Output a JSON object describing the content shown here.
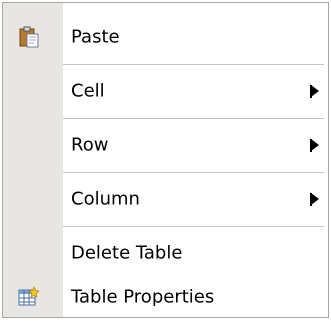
{
  "menu": {
    "items": [
      {
        "label": "Paste",
        "icon": "clipboard-paste-icon",
        "submenu": false
      },
      {
        "label": "Cell",
        "icon": null,
        "submenu": true
      },
      {
        "label": "Row",
        "icon": null,
        "submenu": true
      },
      {
        "label": "Column",
        "icon": null,
        "submenu": true
      },
      {
        "label": "Delete Table",
        "icon": null,
        "submenu": false
      },
      {
        "label": "Table Properties",
        "icon": "table-properties-icon",
        "submenu": false
      }
    ]
  },
  "colors": {
    "gutter": "#e8e6e2",
    "border": "#a7a6aa",
    "text": "#000000"
  }
}
